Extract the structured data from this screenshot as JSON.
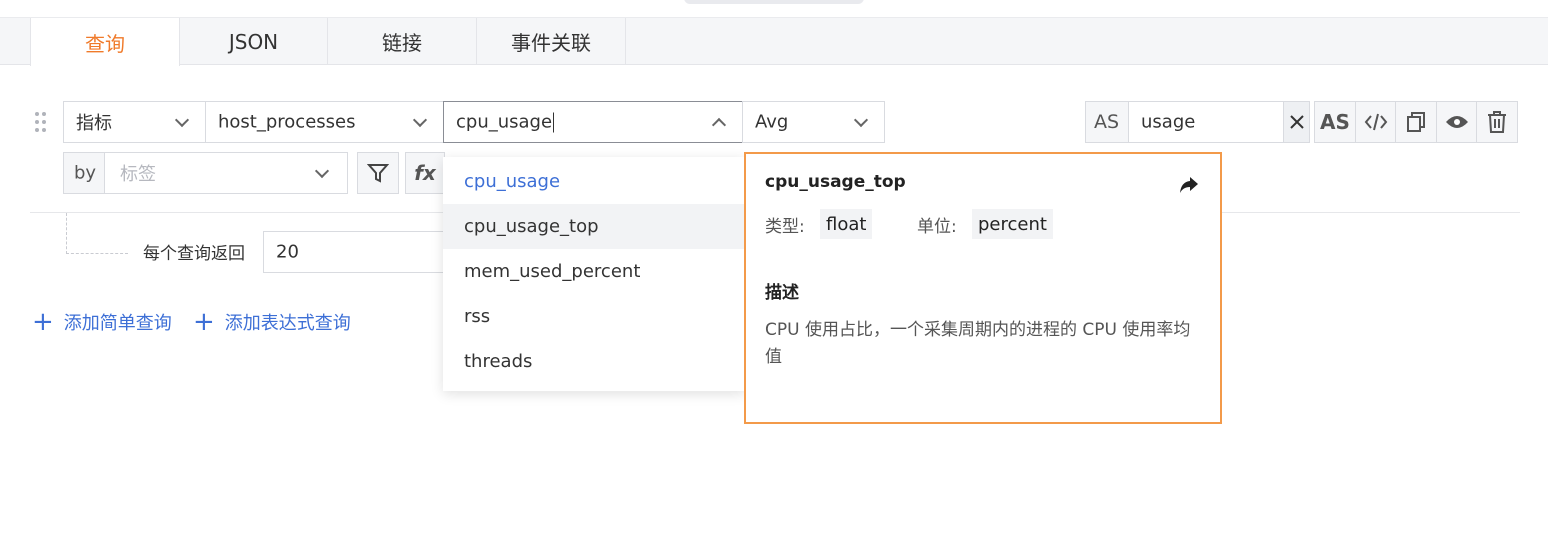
{
  "tabs": [
    {
      "label": "查询",
      "active": true
    },
    {
      "label": "JSON",
      "active": false
    },
    {
      "label": "链接",
      "active": false
    },
    {
      "label": "事件关联",
      "active": false
    }
  ],
  "query": {
    "type_select": "指标",
    "measurement_select": "host_processes",
    "field_input": "cpu_usage",
    "aggregate_select": "Avg",
    "by_label": "by",
    "tag_placeholder": "标签",
    "filter_icon": "filter-icon",
    "fx_label": "fx",
    "as_label": "AS",
    "alias_value": "usage",
    "toolbar": {
      "clear_icon": "close-icon",
      "as_button": "AS",
      "code_icon": "code-icon",
      "copy_icon": "copy-icon",
      "preview_icon": "eye-icon",
      "delete_icon": "trash-icon"
    },
    "per_query_label": "每个查询返回",
    "per_query_value": "20"
  },
  "actions": {
    "add_simple": "添加简单查询",
    "add_expression": "添加表达式查询"
  },
  "dropdown": {
    "items": [
      "cpu_usage",
      "cpu_usage_top",
      "mem_used_percent",
      "rss",
      "threads"
    ],
    "selected": "cpu_usage",
    "hovered": "cpu_usage_top"
  },
  "detail": {
    "title": "cpu_usage_top",
    "type_label": "类型:",
    "type_value": "float",
    "unit_label": "单位:",
    "unit_value": "percent",
    "desc_heading": "描述",
    "desc_text": "CPU 使用占比，一个采集周期内的进程的 CPU 使用率均值"
  },
  "colors": {
    "accent": "#f07a2a",
    "link": "#3d6fd6",
    "highlight_border": "#f39a4a"
  }
}
